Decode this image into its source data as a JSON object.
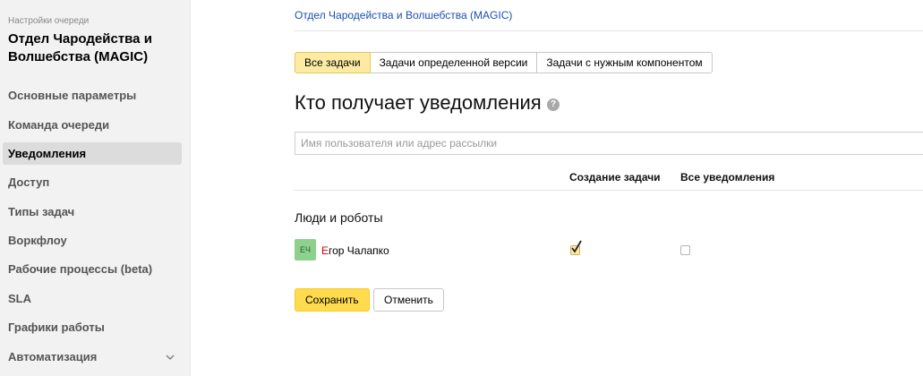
{
  "sidebar": {
    "caption": "Настройки очереди",
    "queue_title": "Отдел Чародейства и Волшебства (MAGIC)",
    "items": [
      {
        "label": "Основные параметры"
      },
      {
        "label": "Команда очереди"
      },
      {
        "label": "Уведомления",
        "active": true
      },
      {
        "label": "Доступ"
      },
      {
        "label": "Типы задач"
      },
      {
        "label": "Воркфлоу"
      },
      {
        "label": "Рабочие процессы (beta)"
      },
      {
        "label": "SLA"
      },
      {
        "label": "Графики работы"
      },
      {
        "label": "Автоматизация"
      }
    ]
  },
  "breadcrumb": "Отдел Чародейства и Волшебства (MAGIC)",
  "tabs": [
    {
      "label": "Все задачи",
      "active": true
    },
    {
      "label": "Задачи определенной версии"
    },
    {
      "label": "Задачи с нужным компонентом"
    }
  ],
  "heading": "Кто получает уведомления",
  "help_icon": "?",
  "search": {
    "placeholder": "Имя пользователя или адрес рассылки",
    "value": ""
  },
  "columns": [
    "Создание задачи",
    "Все уведомления"
  ],
  "section_title": "Люди и роботы",
  "users": [
    {
      "initials": "ЕЧ",
      "name_first_letter": "Е",
      "name_rest": "гор Чалапко",
      "create_task": true,
      "all_notifications": false
    }
  ],
  "buttons": {
    "save": "Сохранить",
    "cancel": "Отменить"
  },
  "colors": {
    "accent": "#ffdb4d",
    "tab_active": "#fdeba4",
    "link": "#1a4fb0",
    "avatar": "#8ed08e"
  }
}
